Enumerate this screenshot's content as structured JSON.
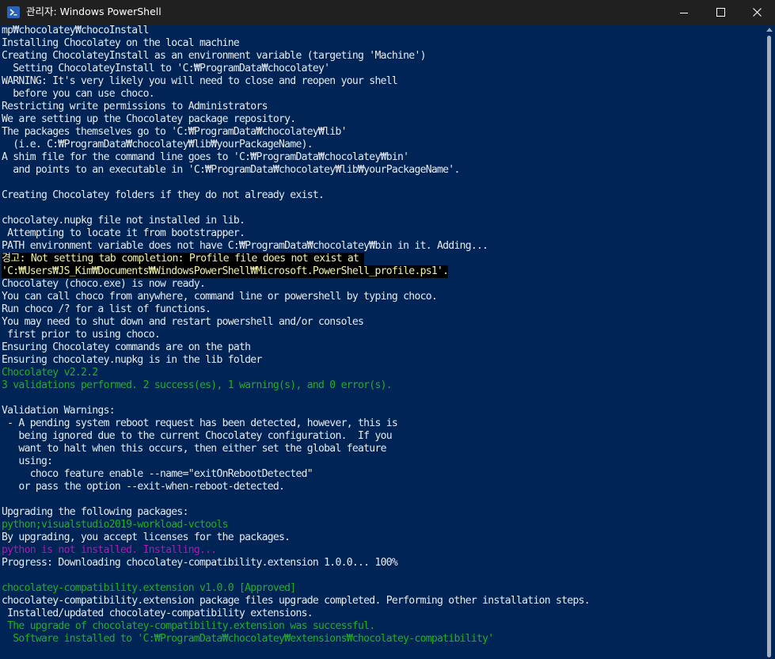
{
  "window": {
    "title": "관리자: Windows PowerShell"
  },
  "icons": {
    "app": "powershell-icon",
    "minimize": "minimize-icon",
    "maximize": "maximize-icon",
    "close": "close-icon"
  },
  "colors": {
    "console_background": "#012456",
    "titlebar_background": "#202020",
    "default_text": "#eaeaea",
    "success_text": "#22b022",
    "error_text": "#b019b0",
    "warning_text": "#f1f1a8",
    "warning_background": "#000000"
  },
  "console": {
    "lines": [
      "mp₩chocolatey₩chocoInstall",
      "Installing Chocolatey on the local machine",
      "Creating ChocolateyInstall as an environment variable (targeting 'Machine')",
      "  Setting ChocolateyInstall to 'C:₩ProgramData₩chocolatey'",
      "WARNING: It's very likely you will need to close and reopen your shell",
      "  before you can use choco.",
      "Restricting write permissions to Administrators",
      "We are setting up the Chocolatey package repository.",
      "The packages themselves go to 'C:₩ProgramData₩chocolatey₩lib'",
      "  (i.e. C:₩ProgramData₩chocolatey₩lib₩yourPackageName).",
      "A shim file for the command line goes to 'C:₩ProgramData₩chocolatey₩bin'",
      "  and points to an executable in 'C:₩ProgramData₩chocolatey₩lib₩yourPackageName'.",
      "",
      "Creating Chocolatey folders if they do not already exist.",
      "",
      "chocolatey.nupkg file not installed in lib.",
      " Attempting to locate it from bootstrapper.",
      "PATH environment variable does not have C:₩ProgramData₩chocolatey₩bin in it. Adding...",
      "경고: Not setting tab completion: Profile file does not exist at ",
      "'C:₩Users₩JS_Kim₩Documents₩WindowsPowerShell₩Microsoft.PowerShell_profile.ps1'.",
      "Chocolatey (choco.exe) is now ready.",
      "You can call choco from anywhere, command line or powershell by typing choco.",
      "Run choco /? for a list of functions.",
      "You may need to shut down and restart powershell and/or consoles",
      " first prior to using choco.",
      "Ensuring Chocolatey commands are on the path",
      "Ensuring chocolatey.nupkg is in the lib folder",
      "Chocolatey v2.2.2",
      "3 validations performed. 2 success(es), 1 warning(s), and 0 error(s).",
      "",
      "Validation Warnings:",
      " - A pending system reboot request has been detected, however, this is",
      "   being ignored due to the current Chocolatey configuration.  If you",
      "   want to halt when this occurs, then either set the global feature",
      "   using:",
      "     choco feature enable --name=\"exitOnRebootDetected\"",
      "   or pass the option --exit-when-reboot-detected.",
      "",
      "Upgrading the following packages:",
      "python;visualstudio2019-workload-vctools",
      "By upgrading, you accept licenses for the packages.",
      "python is not installed. Installing...",
      "Progress: Downloading chocolatey-compatibility.extension 1.0.0... 100%",
      "",
      "chocolatey-compatibility.extension v1.0.0 [Approved]",
      "chocolatey-compatibility.extension package files upgrade completed. Performing other installation steps.",
      " Installed/updated chocolatey-compatibility extensions.",
      " The upgrade of chocolatey-compatibility.extension was successful.",
      "  Software installed to 'C:₩ProgramData₩chocolatey₩extensions₩chocolatey-compatibility'"
    ],
    "line_styles": [
      "default",
      "default",
      "default",
      "default",
      "default",
      "default",
      "default",
      "default",
      "default",
      "default",
      "default",
      "default",
      "default",
      "default",
      "default",
      "default",
      "default",
      "default",
      "warning",
      "warning",
      "default",
      "default",
      "default",
      "default",
      "default",
      "default",
      "default",
      "success",
      "success",
      "default",
      "default",
      "default",
      "default",
      "default",
      "default",
      "default",
      "default",
      "default",
      "default",
      "success",
      "default",
      "error",
      "default",
      "default",
      "success",
      "default",
      "default",
      "success",
      "success"
    ]
  }
}
